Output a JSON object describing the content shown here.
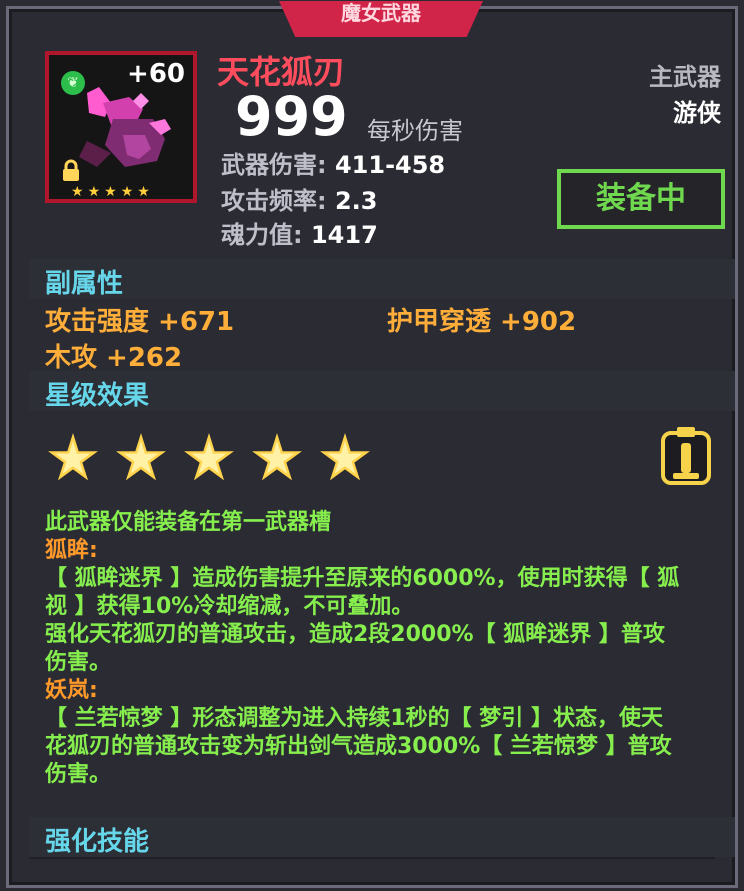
{
  "banner": {
    "label": "魔女武器"
  },
  "item": {
    "name": "天花狐刃",
    "level_badge": "+60",
    "element_icon": "leaf-gem-icon",
    "lock_icon": "lock-icon",
    "dps_value": "999",
    "dps_label": "每秒伤害",
    "stats": [
      {
        "label": "武器伤害:",
        "value": "411-458"
      },
      {
        "label": "攻击频率:",
        "value": "2.3"
      },
      {
        "label": "魂力值:",
        "value": "1417"
      }
    ],
    "stars": 5
  },
  "side": {
    "slot": "主武器",
    "class": "游侠",
    "equipped_button": "装备中"
  },
  "sections": {
    "secondary": "副属性",
    "star_effect": "星级效果",
    "enhance": "强化技能"
  },
  "secondary_attrs": [
    "攻击强度 +671",
    "护甲穿透 +902",
    "木攻 +262"
  ],
  "description": {
    "line1": "此武器仅能装备在第一武器槽",
    "title1": "狐眸:",
    "text1a": "【 狐眸迷界 】造成伤害提升至原来的6000%，使用时获得【 狐",
    "text1b": "视 】获得10%冷却缩减，不可叠加。",
    "text1c": "强化天花狐刃的普通攻击，造成2段2000%【 狐眸迷界 】普攻",
    "text1d": "伤害。",
    "title2": "妖岚:",
    "text2a": "【 兰若惊梦 】形态调整为进入持续1秒的【 梦引 】状态，使天",
    "text2b": "花狐刃的普通攻击变为斩出剑气造成3000%【 兰若惊梦 】普攻",
    "text2c": "伤害。"
  },
  "colors": {
    "accent_red": "#ff4d5e",
    "equipped_green": "#6fd84f",
    "section_cyan": "#66d7ea",
    "attr_orange": "#ffae3a",
    "desc_green": "#86ef4e"
  }
}
